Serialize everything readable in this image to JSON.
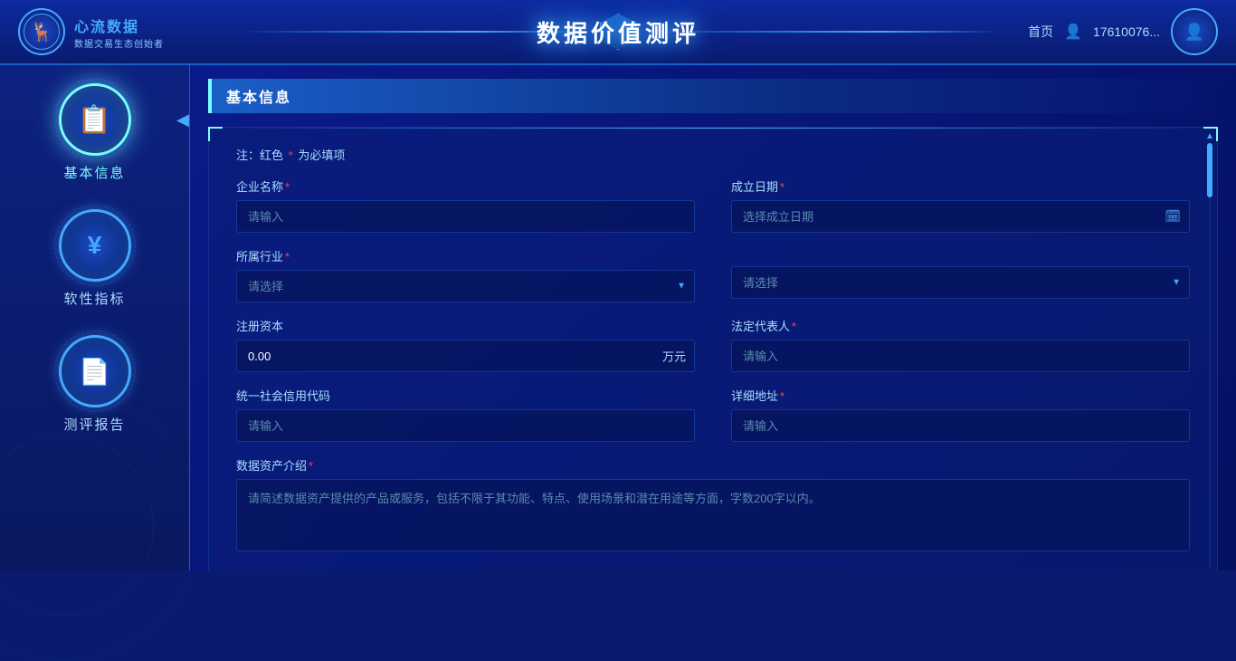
{
  "header": {
    "logo_title": "心流数据",
    "logo_subtitle": "数据交易生态创始者",
    "page_title": "数据价值测评",
    "nav_home": "首页",
    "user_info": "17610076...",
    "logo_icon": "🦌"
  },
  "sidebar": {
    "items": [
      {
        "id": "basic-info",
        "label": "基本信息",
        "icon": "📋",
        "active": true
      },
      {
        "id": "soft-index",
        "label": "软性指标",
        "icon": "¥",
        "active": false
      },
      {
        "id": "eval-report",
        "label": "测评报告",
        "icon": "📄",
        "active": false
      }
    ]
  },
  "section": {
    "title": "基本信息"
  },
  "form": {
    "note_prefix": "注：红色",
    "required_symbol": "*",
    "note_suffix": "为必填项",
    "company_name_label": "企业名称",
    "company_name_placeholder": "请输入",
    "established_date_label": "成立日期",
    "established_date_placeholder": "选择成立日期",
    "industry_label": "所属行业",
    "industry_placeholder": "请选择",
    "industry2_placeholder": "请选择",
    "registered_capital_label": "注册资本",
    "registered_capital_value": "0.00",
    "registered_capital_unit": "万元",
    "legal_rep_label": "法定代表人",
    "legal_rep_placeholder": "请输入",
    "credit_code_label": "统一社会信用代码",
    "credit_code_placeholder": "请输入",
    "address_label": "详细地址",
    "address_placeholder": "请输入",
    "asset_intro_label": "数据资产介绍",
    "asset_intro_placeholder": "请简述数据资产提供的产品或服务，包括不限于其功能、特点、使用场景和潜在用途等方面，字数200字以内。"
  }
}
